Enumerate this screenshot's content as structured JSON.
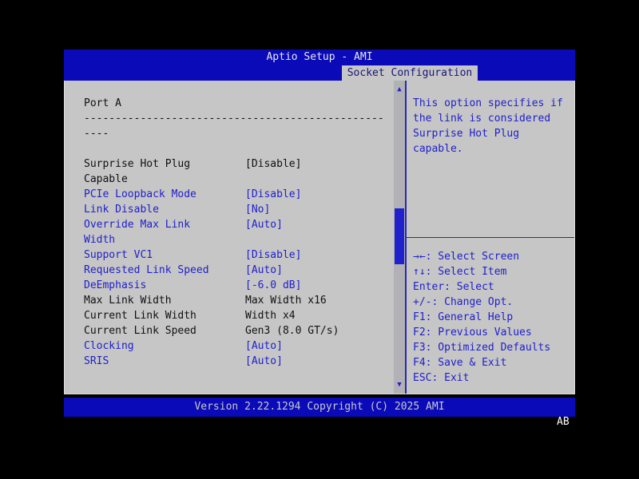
{
  "header": {
    "title": "Aptio Setup - AMI",
    "tab": "Socket Configuration"
  },
  "list": {
    "section_title": "Port A",
    "divider": "----------------------------------------------------",
    "items": [
      {
        "label": "Surprise Hot Plug Capable",
        "value": "[Disable]",
        "state": "selected"
      },
      {
        "label": "PCIe Loopback Mode",
        "value": "[Disable]",
        "state": "editable"
      },
      {
        "label": "Link Disable",
        "value": "[No]",
        "state": "editable"
      },
      {
        "label": "Override Max Link Width",
        "value": "[Auto]",
        "state": "editable"
      },
      {
        "label": "Support VC1",
        "value": "[Disable]",
        "state": "editable"
      },
      {
        "label": "Requested Link Speed",
        "value": "[Auto]",
        "state": "editable"
      },
      {
        "label": "DeEmphasis",
        "value": "[-6.0 dB]",
        "state": "editable"
      },
      {
        "label": "Max Link Width",
        "value": "Max Width x16",
        "state": "readonly"
      },
      {
        "label": "Current Link Width",
        "value": "Width x4",
        "state": "readonly"
      },
      {
        "label": "Current Link Speed",
        "value": "Gen3 (8.0 GT/s)",
        "state": "readonly"
      },
      {
        "label": "Clocking",
        "value": "[Auto]",
        "state": "editable"
      },
      {
        "label": "SRIS",
        "value": "[Auto]",
        "state": "editable"
      }
    ]
  },
  "help": {
    "text": "This option specifies if the link is considered Surprise Hot Plug capable.",
    "keys": [
      "→←: Select Screen",
      "↑↓: Select Item",
      "Enter: Select",
      "+/-: Change Opt.",
      "F1: General Help",
      "F2: Previous Values",
      "F3: Optimized Defaults",
      "F4: Save & Exit",
      "ESC: Exit"
    ]
  },
  "scrollbar": {
    "up_icon": "▲",
    "down_icon": "▼"
  },
  "footer": {
    "version": "Version 2.22.1294 Copyright (C) 2025 AMI",
    "corner": "AB"
  },
  "colors": {
    "bar_blue": "#0a0ab8",
    "panel_gray": "#c6c6c6",
    "option_blue": "#2020cc",
    "text_black": "#101010",
    "line_blue": "#2828a8"
  }
}
